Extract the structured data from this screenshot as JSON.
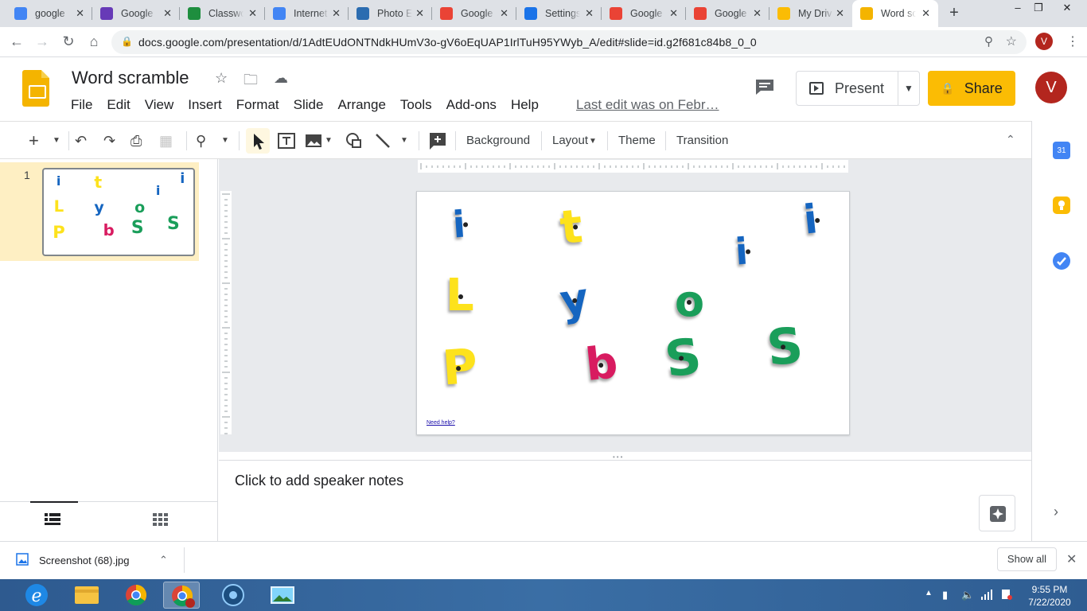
{
  "browser": {
    "tabs": [
      {
        "title": "google",
        "favicon": "docs-icon",
        "color": "#4285f4"
      },
      {
        "title": "Google",
        "favicon": "forms-icon",
        "color": "#673ab7"
      },
      {
        "title": "Classwo",
        "favicon": "classroom-icon",
        "color": "#1e8e3e"
      },
      {
        "title": "Internet",
        "favicon": "account-icon",
        "color": "#4285f4"
      },
      {
        "title": "Photo E",
        "favicon": "photo-editor-icon",
        "color": "#2b6cb0"
      },
      {
        "title": "Google",
        "favicon": "google-icon",
        "color": "#ea4335"
      },
      {
        "title": "Settings",
        "favicon": "settings-gear-icon",
        "color": "#1a73e8"
      },
      {
        "title": "Google",
        "favicon": "google-icon",
        "color": "#ea4335"
      },
      {
        "title": "Google",
        "favicon": "google-icon",
        "color": "#ea4335"
      },
      {
        "title": "My Driv",
        "favicon": "drive-icon",
        "color": "#fbbc04"
      },
      {
        "title": "Word sc",
        "favicon": "slides-icon",
        "color": "#f4b400",
        "active": true
      }
    ],
    "url": "docs.google.com/presentation/d/1AdtEUdONTNdkHUmV3o-gV6oEqUAP1IrlTuH95YWyb_A/edit#slide=id.g2f681c84b8_0_0",
    "profile_initial": "V"
  },
  "app": {
    "title": "Word scramble",
    "menu": [
      "File",
      "Edit",
      "View",
      "Insert",
      "Format",
      "Slide",
      "Arrange",
      "Tools",
      "Add-ons",
      "Help"
    ],
    "last_edit": "Last edit was on Febr…",
    "present_label": "Present",
    "share_label": "Share",
    "avatar_initial": "V",
    "accent": "#fbbc04"
  },
  "toolbar": {
    "background": "Background",
    "layout": "Layout",
    "theme": "Theme",
    "transition": "Transition"
  },
  "filmstrip": {
    "slide_number": "1"
  },
  "slide": {
    "letters": [
      "i",
      "t",
      "i",
      "i",
      "L",
      "y",
      "o",
      "P",
      "b",
      "S",
      "S"
    ],
    "letter_colors": {
      "blue": "#1565c0",
      "yellow": "#fde21c",
      "green": "#1a9e5a",
      "pink": "#d81b60"
    },
    "link_text": "Need help?"
  },
  "notes": {
    "placeholder": "Click to add speaker notes"
  },
  "downloads": {
    "file": "Screenshot (68).jpg",
    "show_all": "Show all"
  },
  "taskbar": {
    "time": "9:55 PM",
    "date": "7/22/2020"
  }
}
